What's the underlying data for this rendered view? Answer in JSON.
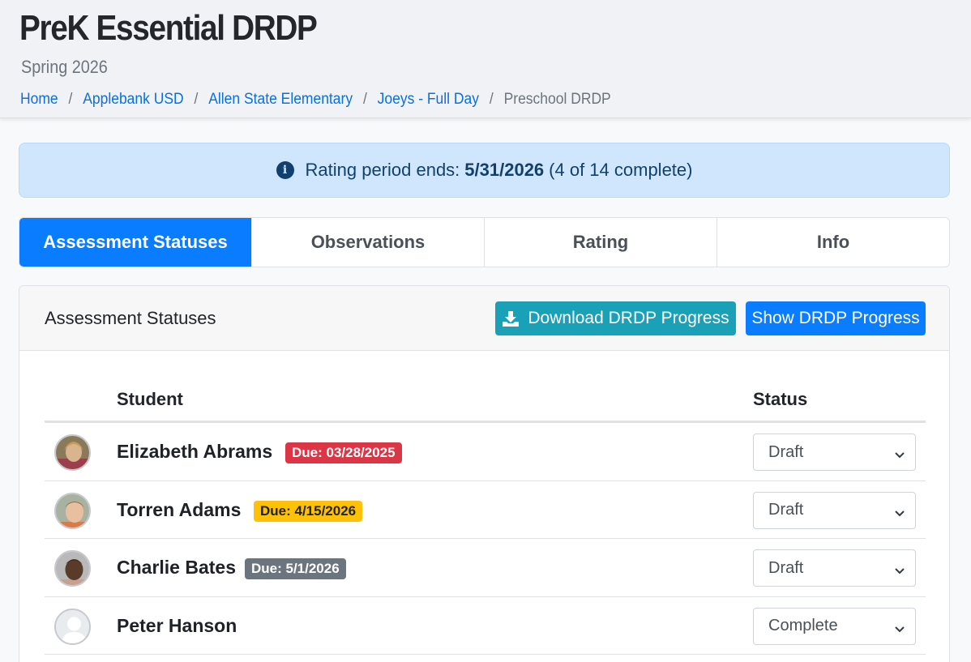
{
  "header": {
    "title": "PreK Essential DRDP",
    "subtitle": "Spring 2026",
    "breadcrumb": [
      "Home",
      "Applebank USD",
      "Allen State Elementary",
      "Joeys - Full Day"
    ],
    "breadcrumb_separator": "/",
    "breadcrumb_current": "Preschool DRDP"
  },
  "alert": {
    "icon": "info-circle-icon",
    "prefix": "Rating period ends:",
    "date": "5/31/2026",
    "suffix": "(4 of 14 complete)"
  },
  "tabs": [
    {
      "label": "Assessment Statuses",
      "active": true
    },
    {
      "label": "Observations",
      "active": false
    },
    {
      "label": "Rating",
      "active": false
    },
    {
      "label": "Info",
      "active": false
    }
  ],
  "card": {
    "title": "Assessment Statuses",
    "download_button": "Download DRDP Progress",
    "download_icon": "download-icon",
    "show_button": "Show DRDP Progress"
  },
  "table": {
    "columns": {
      "student": "Student",
      "status": "Status"
    },
    "rows": [
      {
        "name": "Elizabeth Abrams",
        "due": "Due: 03/28/2025",
        "badge_color": "#dc3545",
        "status": "Draft",
        "avatar": "photo"
      },
      {
        "name": "Torren Adams",
        "due": "Due: 4/15/2026",
        "badge_color": "#ffc107",
        "status": "Draft",
        "avatar": "photo"
      },
      {
        "name": "Charlie Bates",
        "due": "Due: 5/1/2026",
        "badge_color": "#6c757d",
        "status": "Draft",
        "avatar": "photo"
      },
      {
        "name": "Peter Hanson",
        "due": "",
        "badge_color": "",
        "status": "Complete",
        "avatar": "placeholder-user-icon"
      }
    ]
  },
  "colors": {
    "primary": "#0a7cff",
    "info_button": "#1aa1b8",
    "alert_bg": "#cfe6fd",
    "link": "#0a6fe0"
  }
}
